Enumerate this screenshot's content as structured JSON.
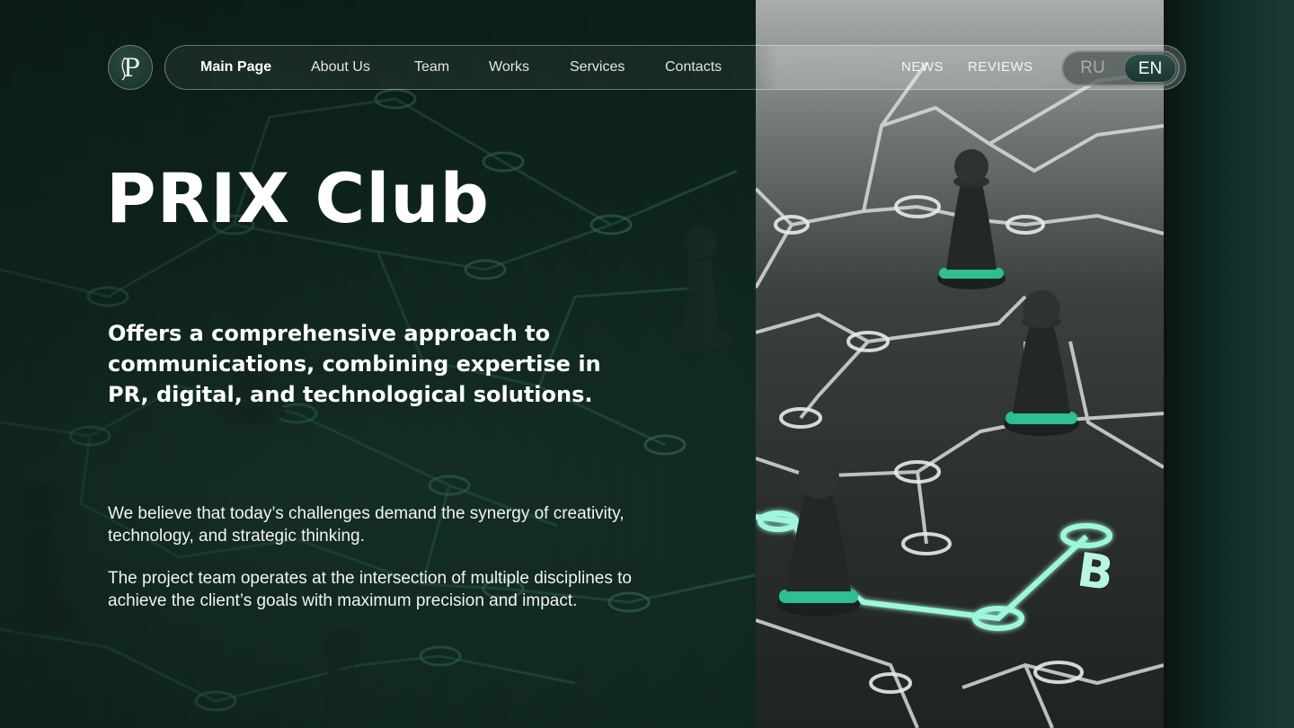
{
  "brand": {
    "logo_text": "P",
    "title": "PRIX Club"
  },
  "nav": {
    "items": [
      {
        "label": "Main Page",
        "active": true
      },
      {
        "label": "About Us"
      },
      {
        "label": "Team"
      },
      {
        "label": "Works"
      },
      {
        "label": "Services"
      },
      {
        "label": "Contacts"
      }
    ],
    "right": {
      "news": "NEWS",
      "reviews": "REVIEWS"
    },
    "lang": {
      "ru": "RU",
      "en": "EN",
      "selected": "EN"
    }
  },
  "hero": {
    "subtitle": "Offers a comprehensive approach to communications, combining expertise in PR, digital, and technological solutions.",
    "paragraph_1": "We believe that today’s challenges demand the synergy of creativity, technology, and strategic thinking.",
    "paragraph_2": "The project team operates at the intersection of multiple disciplines to achieve the client’s goals with maximum precision and impact."
  },
  "photo": {
    "board_letter": "B"
  },
  "colors": {
    "background": "#112822",
    "accent_glow": "#7ff0d2",
    "text": "#ffffff"
  }
}
